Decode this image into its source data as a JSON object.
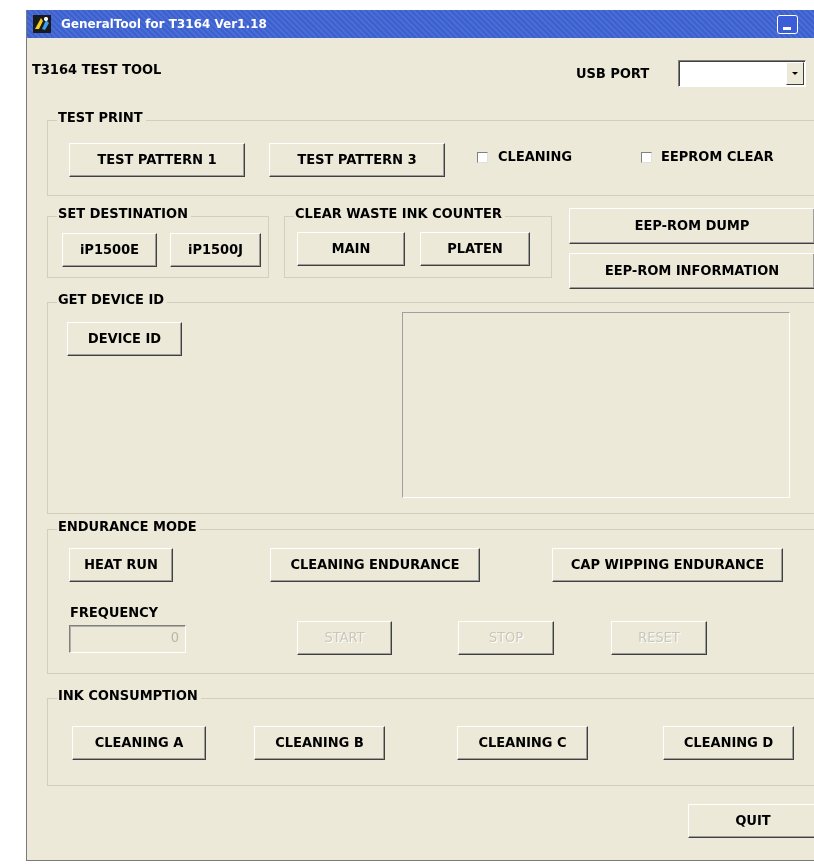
{
  "window": {
    "title": "GeneralTool for T3164 Ver1.18"
  },
  "header": {
    "tool_title": "T3164 TEST TOOL",
    "usb_port_label": "USB PORT",
    "usb_port_value": ""
  },
  "test_print": {
    "group_label": "TEST PRINT",
    "pattern1_label": "TEST PATTERN 1",
    "pattern3_label": "TEST PATTERN 3",
    "cleaning_label": "CLEANING",
    "cleaning_checked": false,
    "eeprom_clear_label": "EEPROM CLEAR",
    "eeprom_clear_checked": false
  },
  "set_destination": {
    "group_label": "SET DESTINATION",
    "ip1500e_label": "iP1500E",
    "ip1500j_label": "iP1500J"
  },
  "clear_waste": {
    "group_label": "CLEAR WASTE INK COUNTER",
    "main_label": "MAIN",
    "platen_label": "PLATEN"
  },
  "eeprom": {
    "dump_label": "EEP-ROM DUMP",
    "information_label": "EEP-ROM INFORMATION"
  },
  "device_id": {
    "group_label": "GET DEVICE ID",
    "button_label": "DEVICE ID"
  },
  "endurance": {
    "group_label": "ENDURANCE MODE",
    "heat_run_label": "HEAT RUN",
    "cleaning_endurance_label": "CLEANING ENDURANCE",
    "cap_wipping_label": "CAP WIPPING ENDURANCE",
    "frequency_label": "FREQUENCY",
    "frequency_value": "0",
    "start_label": "START",
    "stop_label": "STOP",
    "reset_label": "RESET"
  },
  "ink_consumption": {
    "group_label": "INK CONSUMPTION",
    "cleaning_a_label": "CLEANING A",
    "cleaning_b_label": "CLEANING B",
    "cleaning_c_label": "CLEANING C",
    "cleaning_d_label": "CLEANING D"
  },
  "footer": {
    "quit_label": "QUIT"
  },
  "colors": {
    "face": "#ece9d8",
    "titlebar": "#3f63d0"
  }
}
